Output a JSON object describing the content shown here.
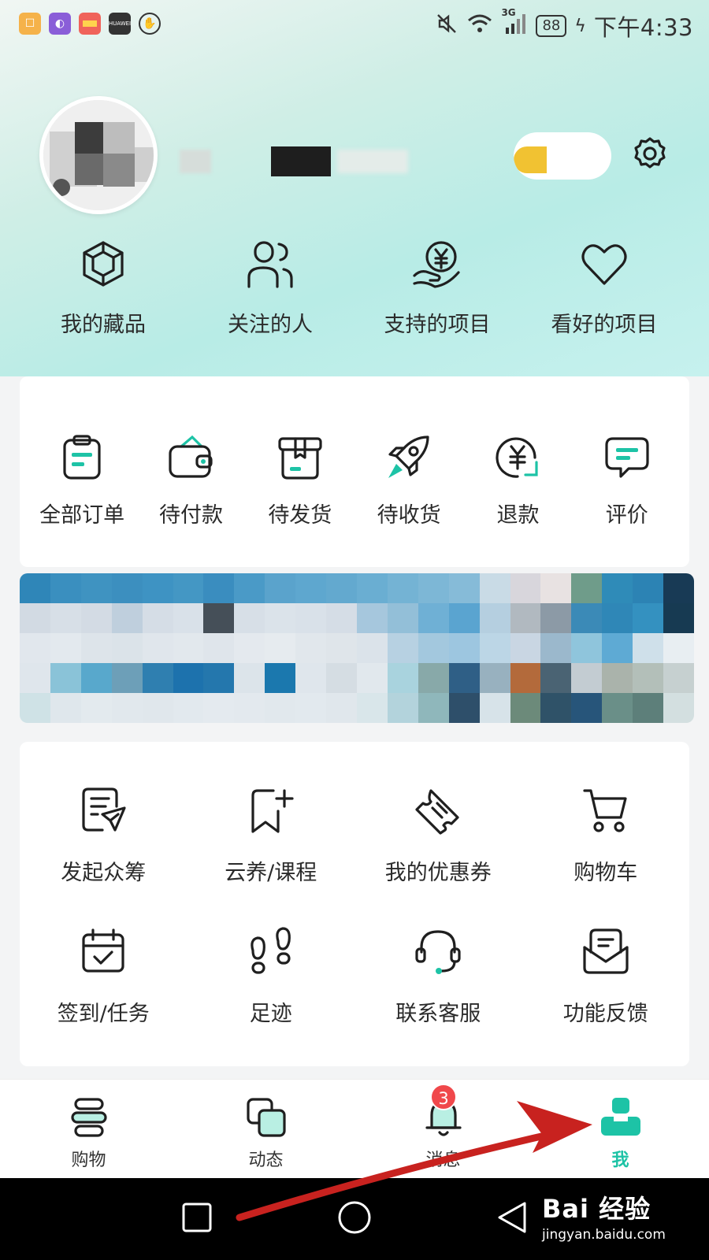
{
  "status_bar": {
    "notification_icons": [
      "app-icon-1",
      "app-icon-2",
      "app-icon-3",
      "huawei-icon",
      "app-icon-5"
    ],
    "network": "3G",
    "battery": "88",
    "time": "下午4:33"
  },
  "profile": {
    "avatar": "avatar"
  },
  "quick_links": [
    {
      "label": "我的藏品",
      "icon": "cube-icon"
    },
    {
      "label": "关注的人",
      "icon": "people-icon"
    },
    {
      "label": "支持的项目",
      "icon": "yen-hand-icon"
    },
    {
      "label": "看好的项目",
      "icon": "heart-icon"
    }
  ],
  "orders": [
    {
      "label": "全部订单",
      "icon": "clipboard-icon"
    },
    {
      "label": "待付款",
      "icon": "wallet-icon"
    },
    {
      "label": "待发货",
      "icon": "box-icon"
    },
    {
      "label": "待收货",
      "icon": "rocket-icon"
    },
    {
      "label": "退款",
      "icon": "yen-refund-icon"
    },
    {
      "label": "评价",
      "icon": "comment-icon"
    }
  ],
  "tools": [
    {
      "label": "发起众筹",
      "icon": "document-send-icon"
    },
    {
      "label": "云养/课程",
      "icon": "bookmark-add-icon"
    },
    {
      "label": "我的优惠券",
      "icon": "ticket-icon"
    },
    {
      "label": "购物车",
      "icon": "cart-icon"
    },
    {
      "label": "签到/任务",
      "icon": "calendar-check-icon"
    },
    {
      "label": "足迹",
      "icon": "footprints-icon"
    },
    {
      "label": "联系客服",
      "icon": "headset-icon"
    },
    {
      "label": "功能反馈",
      "icon": "mail-feedback-icon"
    }
  ],
  "tab_bar": {
    "items": [
      {
        "label": "购物",
        "icon": "shopping-icon"
      },
      {
        "label": "动态",
        "icon": "dynamics-icon"
      },
      {
        "label": "消息",
        "icon": "bell-icon",
        "badge": "3"
      },
      {
        "label": "我",
        "icon": "profile-icon",
        "active": true
      }
    ]
  },
  "watermark": {
    "logo": "Bai 经验",
    "url": "jingyan.baidu.com"
  },
  "colors": {
    "accent": "#1dc3a6",
    "badge": "#f0484b",
    "annotation_arrow": "#c8221f"
  }
}
